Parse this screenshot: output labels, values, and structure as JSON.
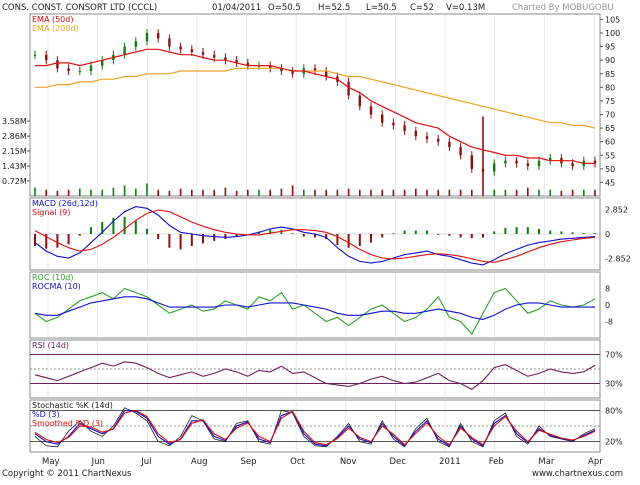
{
  "header": {
    "company": "CONS. CONST. CONSORT LTD (CCCL)",
    "date": "01/04/2011",
    "open": "O=50.5",
    "high": "H=52.5",
    "low": "L=50.5",
    "close": "C=52",
    "volume": "V=0.13M",
    "credit": "Charted By MOBUGOBU"
  },
  "footer": {
    "copyright": "Copyright © 2011 ChartNexus",
    "brand": "www.chartnexus.com"
  },
  "colors": {
    "price_up": "#0f7a0f",
    "price_down": "#8b1010",
    "ema50": "#e01010",
    "ema200": "#f0a020",
    "macd": "#1010d0",
    "signal": "#e01010",
    "roc": "#30a030",
    "rocma": "#1010d0",
    "rsi": "#702060",
    "stoch_k": "#202020",
    "stoch_d": "#1010d0",
    "stoch_smooth": "#e01010",
    "grid": "#aaaaaa"
  },
  "chart_data": [
    {
      "type": "candlestick",
      "panel": "price",
      "legend": [
        "EMA (50d)",
        "EMA (200d)"
      ],
      "y_ticks": [
        "105",
        "100",
        "95",
        "90",
        "85",
        "80",
        "75",
        "70",
        "65",
        "60",
        "55",
        "50",
        "45"
      ],
      "y_tick_values": [
        105,
        100,
        95,
        90,
        85,
        80,
        75,
        70,
        65,
        60,
        55,
        50,
        45
      ],
      "ylim": [
        40,
        107
      ],
      "volume_ticks": [
        "3.58M",
        "2.86M",
        "2.15M",
        "1.43M",
        "0.72M"
      ],
      "volume_tick_values": [
        3.58,
        2.86,
        2.15,
        1.43,
        0.72
      ],
      "volume_ylim": [
        0,
        4.3
      ],
      "x_labels": [
        "May",
        "Jun",
        "Jul",
        "Aug",
        "Sep",
        "Oct",
        "Nov",
        "Dec",
        "2011",
        "Feb",
        "Mar",
        "Apr"
      ],
      "price_series": [
        {
          "name": "Close",
          "values": [
            92,
            90,
            87,
            86,
            86,
            88,
            90,
            92,
            95,
            97,
            100,
            98,
            95,
            94,
            93,
            92,
            91,
            90,
            89,
            88,
            88,
            87,
            86,
            85,
            87,
            86,
            84,
            82,
            77,
            73,
            70,
            67,
            66,
            64,
            62,
            61,
            60,
            58,
            55,
            50,
            49,
            52,
            53,
            52,
            51,
            53,
            54,
            52,
            51,
            53,
            52
          ]
        },
        {
          "name": "EMA (50d)",
          "values": [
            88,
            88,
            89,
            89,
            88,
            89,
            90,
            91,
            92,
            93,
            94,
            94,
            93,
            92,
            92,
            91,
            90,
            90,
            89,
            88,
            88,
            88,
            87,
            86,
            86,
            85,
            84,
            83,
            80,
            78,
            75,
            73,
            71,
            69,
            67,
            66,
            65,
            62,
            60,
            58,
            57,
            56,
            55,
            55,
            54,
            54,
            53,
            53,
            53,
            52,
            52
          ]
        },
        {
          "name": "EMA (200d)",
          "values": [
            80,
            80,
            81,
            81,
            82,
            82,
            83,
            83,
            84,
            84,
            85,
            85,
            85,
            86,
            86,
            86,
            86,
            86,
            87,
            87,
            87,
            87,
            87,
            86,
            86,
            86,
            86,
            85,
            84,
            84,
            83,
            82,
            81,
            80,
            79,
            78,
            77,
            76,
            75,
            74,
            73,
            72,
            71,
            70,
            69,
            68,
            67,
            67,
            66,
            66,
            65
          ]
        }
      ],
      "volume_values": [
        0.4,
        0.3,
        0.25,
        0.3,
        0.35,
        0.3,
        0.3,
        0.4,
        0.5,
        0.35,
        0.6,
        0.3,
        0.25,
        0.35,
        0.3,
        0.3,
        0.3,
        0.4,
        0.25,
        0.3,
        0.3,
        0.3,
        0.35,
        0.5,
        0.3,
        0.3,
        0.3,
        0.3,
        0.35,
        0.3,
        0.3,
        0.3,
        0.3,
        0.3,
        0.35,
        0.3,
        0.3,
        0.3,
        0.3,
        0.3,
        3.8,
        0.3,
        0.3,
        0.3,
        0.4,
        0.3,
        0.3,
        0.25,
        0.3,
        0.3,
        0.3
      ]
    },
    {
      "type": "line",
      "panel": "macd",
      "legend": [
        "MACD (26d,12d)",
        "Signal (9)"
      ],
      "y_ticks": [
        "2.852",
        "0",
        "-2.852"
      ],
      "y_tick_values": [
        2.852,
        0,
        -2.852
      ],
      "ylim": [
        -4.2,
        4.2
      ],
      "series": [
        {
          "name": "MACD (26d,12d)",
          "values": [
            -1.0,
            -2.0,
            -2.6,
            -2.8,
            -2.2,
            -1.0,
            0.2,
            1.5,
            2.6,
            3.2,
            3.0,
            2.2,
            1.0,
            0.2,
            0.0,
            -0.2,
            -0.3,
            -0.4,
            -0.3,
            -0.1,
            0.2,
            0.6,
            0.8,
            0.6,
            0.2,
            0.0,
            -0.4,
            -1.6,
            -2.6,
            -3.2,
            -3.4,
            -3.2,
            -2.8,
            -2.4,
            -2.2,
            -2.0,
            -2.4,
            -2.6,
            -3.0,
            -3.4,
            -3.6,
            -3.0,
            -2.3,
            -1.8,
            -1.3,
            -1.0,
            -0.8,
            -0.6,
            -0.5,
            -0.4,
            -0.3
          ]
        },
        {
          "name": "Signal (9)",
          "values": [
            0.4,
            -0.3,
            -1.0,
            -1.6,
            -2.0,
            -1.8,
            -1.2,
            -0.4,
            0.6,
            1.6,
            2.4,
            2.8,
            2.6,
            2.0,
            1.4,
            0.9,
            0.5,
            0.2,
            0.0,
            -0.1,
            -0.1,
            0.1,
            0.3,
            0.5,
            0.5,
            0.4,
            0.2,
            -0.3,
            -1.0,
            -1.8,
            -2.4,
            -2.8,
            -2.9,
            -2.8,
            -2.6,
            -2.4,
            -2.3,
            -2.4,
            -2.6,
            -2.9,
            -3.2,
            -3.3,
            -3.0,
            -2.6,
            -2.1,
            -1.6,
            -1.2,
            -0.9,
            -0.7,
            -0.5,
            -0.4
          ]
        }
      ]
    },
    {
      "type": "line",
      "panel": "roc",
      "legend": [
        "ROC (10d)",
        "ROCMA (10)"
      ],
      "y_ticks": [
        "8",
        "0",
        "-8"
      ],
      "y_tick_values": [
        8,
        0,
        -8
      ],
      "ylim": [
        -16,
        16
      ],
      "series": [
        {
          "name": "ROC (10d)",
          "values": [
            -4,
            -8,
            -6,
            -2,
            2,
            4,
            6,
            3,
            8,
            6,
            4,
            0,
            -4,
            -2,
            0,
            -3,
            -2,
            2,
            0,
            -2,
            4,
            2,
            6,
            -2,
            0,
            -4,
            -8,
            -6,
            -10,
            -6,
            -2,
            0,
            -4,
            -8,
            -6,
            -2,
            4,
            -6,
            -8,
            -14,
            -4,
            6,
            8,
            2,
            -4,
            -2,
            2,
            0,
            -1,
            0,
            3
          ]
        },
        {
          "name": "ROCMA (10)",
          "values": [
            -4,
            -5,
            -5,
            -3,
            -1,
            1,
            2,
            3,
            4,
            4,
            3,
            1,
            -1,
            -1,
            -1,
            -1,
            -1,
            0,
            0,
            -1,
            0,
            1,
            1,
            1,
            0,
            -1,
            -2,
            -4,
            -5,
            -5,
            -4,
            -3,
            -3,
            -4,
            -4,
            -3,
            -2,
            -3,
            -4,
            -6,
            -7,
            -5,
            -2,
            0,
            1,
            1,
            0,
            -1,
            -1,
            -1,
            -1
          ]
        }
      ]
    },
    {
      "type": "line",
      "panel": "rsi",
      "legend": [
        "RSI (14d)"
      ],
      "y_ticks": [
        "70%",
        "30%"
      ],
      "y_tick_values": [
        70,
        30
      ],
      "ylim": [
        10,
        90
      ],
      "series": [
        {
          "name": "RSI (14d)",
          "values": [
            42,
            38,
            34,
            40,
            46,
            52,
            58,
            54,
            60,
            58,
            52,
            44,
            38,
            42,
            46,
            40,
            44,
            50,
            46,
            40,
            48,
            46,
            54,
            44,
            46,
            38,
            30,
            28,
            26,
            30,
            36,
            40,
            34,
            30,
            32,
            38,
            44,
            34,
            30,
            22,
            34,
            52,
            56,
            48,
            40,
            44,
            50,
            46,
            44,
            46,
            55
          ]
        }
      ]
    },
    {
      "type": "line",
      "panel": "stochastic",
      "legend": [
        "Stochastic %K (14d)",
        "%D (3)",
        "Smoothed %D (3)"
      ],
      "y_ticks": [
        "80%",
        "20%"
      ],
      "y_tick_values": [
        80,
        20
      ],
      "ylim": [
        0,
        100
      ],
      "series": [
        {
          "name": "Stochastic %K (14d)",
          "values": [
            30,
            12,
            10,
            40,
            60,
            40,
            30,
            50,
            85,
            75,
            60,
            20,
            12,
            30,
            70,
            60,
            25,
            20,
            55,
            60,
            20,
            15,
            80,
            75,
            30,
            12,
            10,
            30,
            55,
            20,
            15,
            60,
            25,
            10,
            45,
            65,
            20,
            10,
            55,
            20,
            10,
            60,
            75,
            30,
            15,
            50,
            30,
            25,
            20,
            35,
            45
          ]
        },
        {
          "name": "%D (3)",
          "values": [
            35,
            20,
            15,
            30,
            55,
            45,
            35,
            45,
            80,
            78,
            65,
            30,
            15,
            25,
            60,
            60,
            30,
            22,
            50,
            58,
            25,
            18,
            70,
            78,
            35,
            15,
            12,
            28,
            50,
            25,
            18,
            55,
            30,
            12,
            40,
            60,
            25,
            12,
            50,
            25,
            12,
            55,
            70,
            35,
            18,
            45,
            32,
            26,
            22,
            32,
            42
          ]
        },
        {
          "name": "Smoothed %D (3)",
          "values": [
            38,
            24,
            18,
            28,
            50,
            48,
            38,
            44,
            75,
            80,
            68,
            35,
            18,
            24,
            55,
            62,
            35,
            24,
            46,
            56,
            30,
            20,
            65,
            78,
            40,
            18,
            14,
            26,
            46,
            28,
            20,
            50,
            34,
            14,
            36,
            56,
            30,
            14,
            46,
            28,
            14,
            50,
            68,
            40,
            20,
            42,
            34,
            27,
            23,
            30,
            40
          ]
        }
      ]
    }
  ]
}
